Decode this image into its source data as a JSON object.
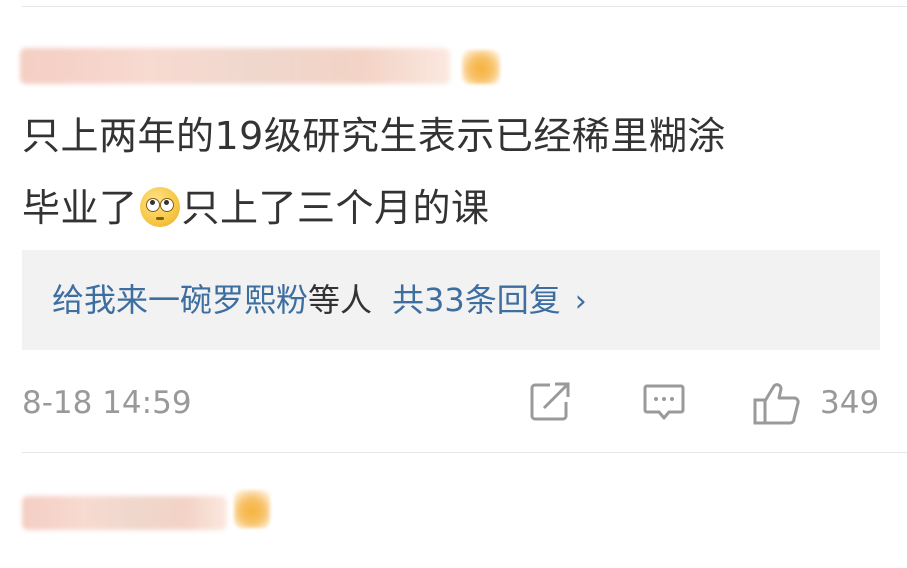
{
  "comment1": {
    "text_line1": "只上两年的19级研究生表示已经稀里糊涂",
    "text_line2_a": "毕业了",
    "emoji": "rolling-eyes-emoji",
    "text_line2_b": "只上了三个月的课",
    "replies": {
      "names": "给我来一碗罗熙粉",
      "suffix": "等人",
      "count": "共33条回复",
      "chevron": "›"
    },
    "time": "8-18 14:59",
    "like_count": "349"
  },
  "colors": {
    "link_blue": "#3e6ea0",
    "meta_gray": "#999999",
    "reply_bg": "#f2f2f2"
  }
}
